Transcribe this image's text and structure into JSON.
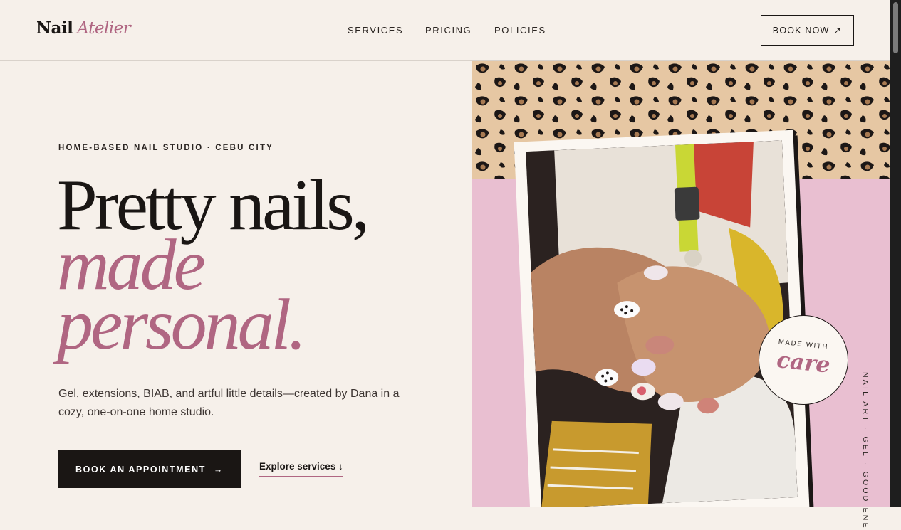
{
  "header": {
    "logo_bold": "Nail",
    "logo_italic": "Atelier",
    "nav": [
      "SERVICES",
      "PRICING",
      "POLICIES"
    ],
    "book_now": "BOOK NOW",
    "book_now_icon": "arrow-up-right-icon"
  },
  "hero": {
    "eyebrow": "HOME-BASED NAIL STUDIO · CEBU CITY",
    "headline_1": "Pretty nails,",
    "headline_2": "made",
    "headline_3": "personal.",
    "description": "Gel, extensions, BIAB, and artful little details—created by Dana in a cozy, one-on-one home studio.",
    "cta_label": "BOOK AN APPOINTMENT",
    "cta_icon": "arrow-right-icon",
    "explore_label": "Explore services",
    "explore_icon": "arrow-down-icon"
  },
  "visual": {
    "badge_top": "MADE WITH",
    "badge_word": "care",
    "vertical_text": "NAIL ART · GEL · GOOD ENE"
  },
  "colors": {
    "accent": "#b06682",
    "background": "#f6f0ea",
    "dark": "#1a1614",
    "pink_panel": "#e9bfd1",
    "leopard": "#e6c7a3"
  }
}
